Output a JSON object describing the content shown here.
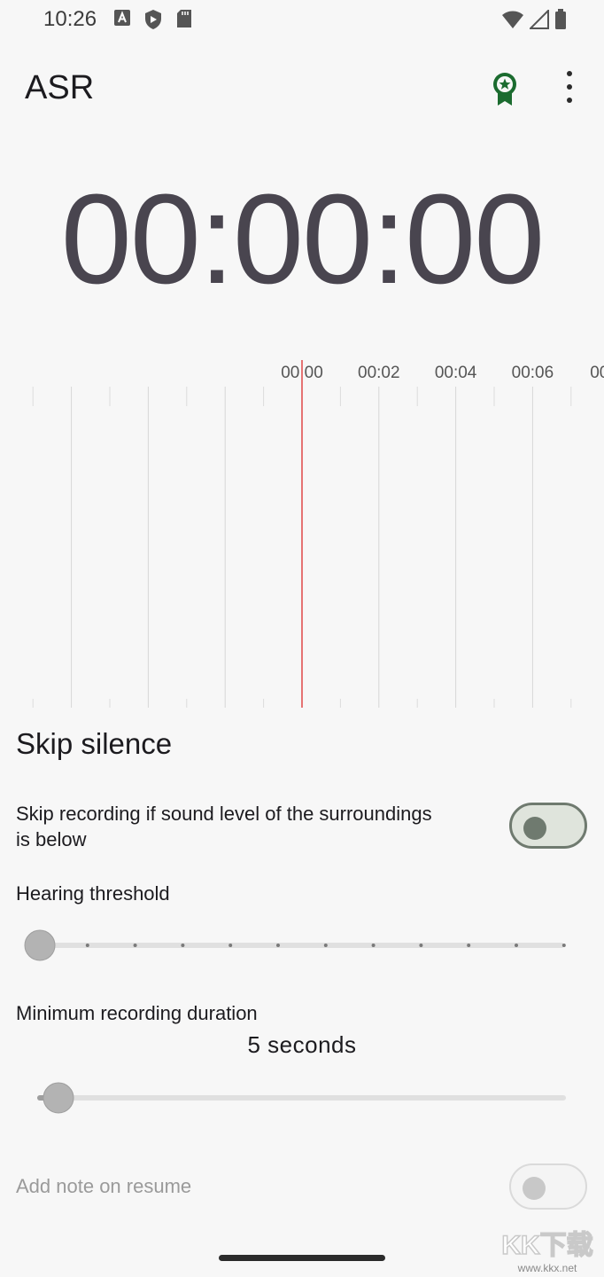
{
  "status_bar": {
    "time": "10:26"
  },
  "app_bar": {
    "title": "ASR"
  },
  "timer": {
    "value": "00:00:00"
  },
  "timeline": {
    "ticks": [
      "00:00",
      "00:02",
      "00:04",
      "00:06",
      "00"
    ]
  },
  "skip_silence": {
    "title": "Skip silence",
    "toggle_description": "Skip recording if sound level of the surroundings is below",
    "toggle_on": false,
    "hearing_threshold_label": "Hearing threshold",
    "hearing_threshold_level": 0,
    "min_duration_label": "Minimum recording duration",
    "min_duration_value": "5 seconds",
    "min_duration_fraction": 0.04
  },
  "add_note": {
    "label": "Add note on resume",
    "toggle_on": false
  },
  "watermark": {
    "line1": "KK下载",
    "line2": "www.kkx.net"
  },
  "colors": {
    "accent_green": "#1b6b2f",
    "playhead_red": "#e57373",
    "timer_text": "#49454f"
  }
}
